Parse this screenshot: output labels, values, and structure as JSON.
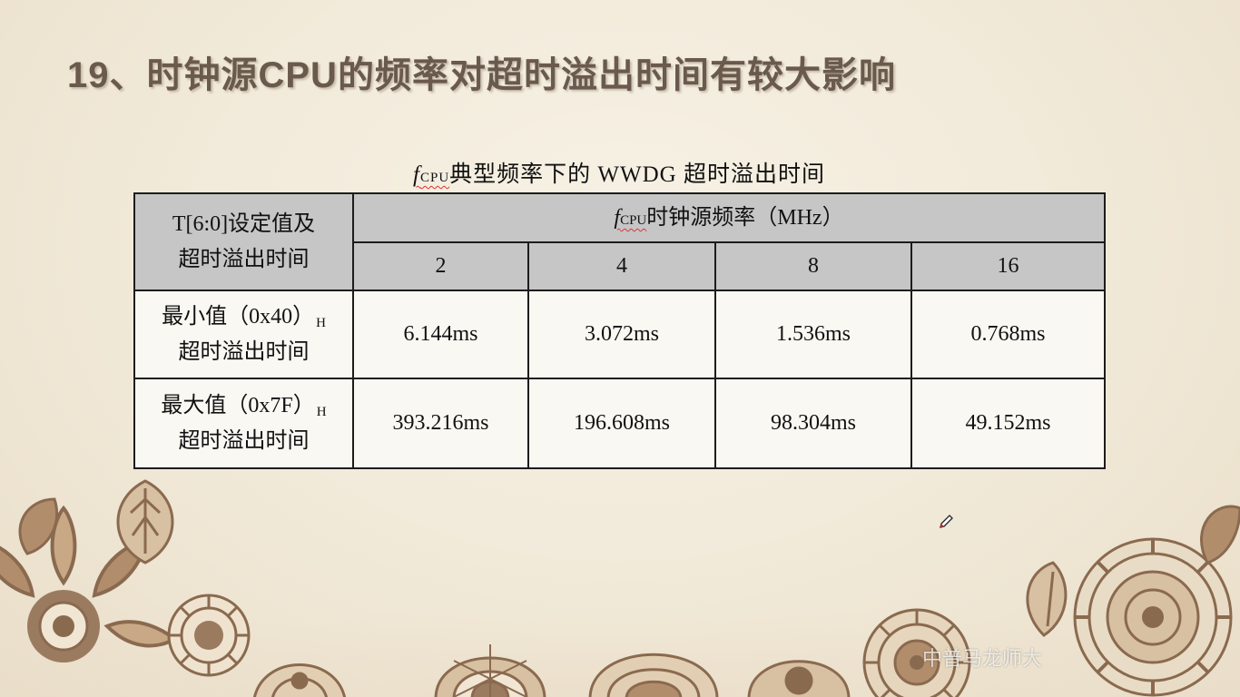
{
  "slide": {
    "title": "19、时钟源CPU的频率对超时溢出时间有较大影响"
  },
  "caption": {
    "symbol": "f",
    "subscript": "CPU",
    "text": "典型频率下的 WWDG 超时溢出时间"
  },
  "table": {
    "corner_header": {
      "line1": "T[6:0]设定值及",
      "line2": "超时溢出时间"
    },
    "group_header": {
      "symbol": "f",
      "subscript": "CPU",
      "text": "时钟源频率（MHz）"
    },
    "frequencies": [
      "2",
      "4",
      "8",
      "16"
    ],
    "rows": [
      {
        "label_line1": "最小值（0x40）",
        "label_sub": "H",
        "label_line2": "超时溢出时间",
        "values": [
          "6.144ms",
          "3.072ms",
          "1.536ms",
          "0.768ms"
        ]
      },
      {
        "label_line1": "最大值（0x7F）",
        "label_sub": "H",
        "label_line2": "超时溢出时间",
        "values": [
          "393.216ms",
          "196.608ms",
          "98.304ms",
          "49.152ms"
        ]
      }
    ]
  },
  "watermark": {
    "text": "中普马龙师大"
  },
  "icons": {
    "pen_cursor": "pen-icon",
    "decoration": "mandala-ornament"
  },
  "colors": {
    "title": "#6a5a4e",
    "header_fill": "#c6c6c6",
    "ornament": "#8a6a4f",
    "background": "#f1e9d8"
  }
}
